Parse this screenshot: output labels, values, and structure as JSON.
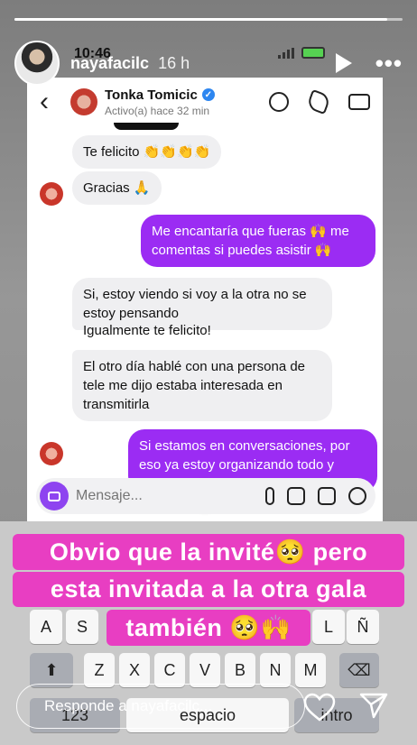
{
  "status": {
    "time": "10:46"
  },
  "story": {
    "username": "nayafacilc",
    "posted_ago": "16 h",
    "progress": 0.96
  },
  "chat": {
    "contact_name": "Tonka Tomicic",
    "contact_status": "Activo(a) hace 32 min",
    "messages": [
      {
        "side": "recv",
        "text": "Te felicito 👏👏👏👏"
      },
      {
        "side": "recv",
        "text": "Gracias 🙏"
      },
      {
        "side": "sent",
        "text": "Me encantaría que fueras 🙌 me comentas si puedes asistir 🙌"
      },
      {
        "side": "recv",
        "text": "Si, estoy viendo si voy a la otra no se estoy pensando"
      },
      {
        "side": "recv",
        "text": "Igualmente te felicito!"
      },
      {
        "side": "recv",
        "text": "El otro día hablé con una persona de tele me dijo estaba interesada en transmitirla"
      },
      {
        "side": "sent",
        "text": "Si estamos en conversaciones, por eso ya estoy organizando todo y enviando las invitaciones"
      }
    ],
    "composer_placeholder": "Mensaje..."
  },
  "captions": [
    "Obvio que la invité🥺 pero",
    "esta invitada a la otra gala",
    "también 🥺🙌"
  ],
  "keyboard": {
    "row2": [
      "A",
      "S",
      "L",
      "Ñ"
    ],
    "row3": [
      "Z",
      "X",
      "C",
      "V",
      "B",
      "N",
      "M"
    ],
    "bottom": [
      "123",
      "espacio",
      "intro"
    ]
  },
  "reply": {
    "placeholder": "Responde a nayafacilc..."
  },
  "colors": {
    "caption_bg": "#e83ec2",
    "sent_bubble": "#9b2cf3"
  }
}
